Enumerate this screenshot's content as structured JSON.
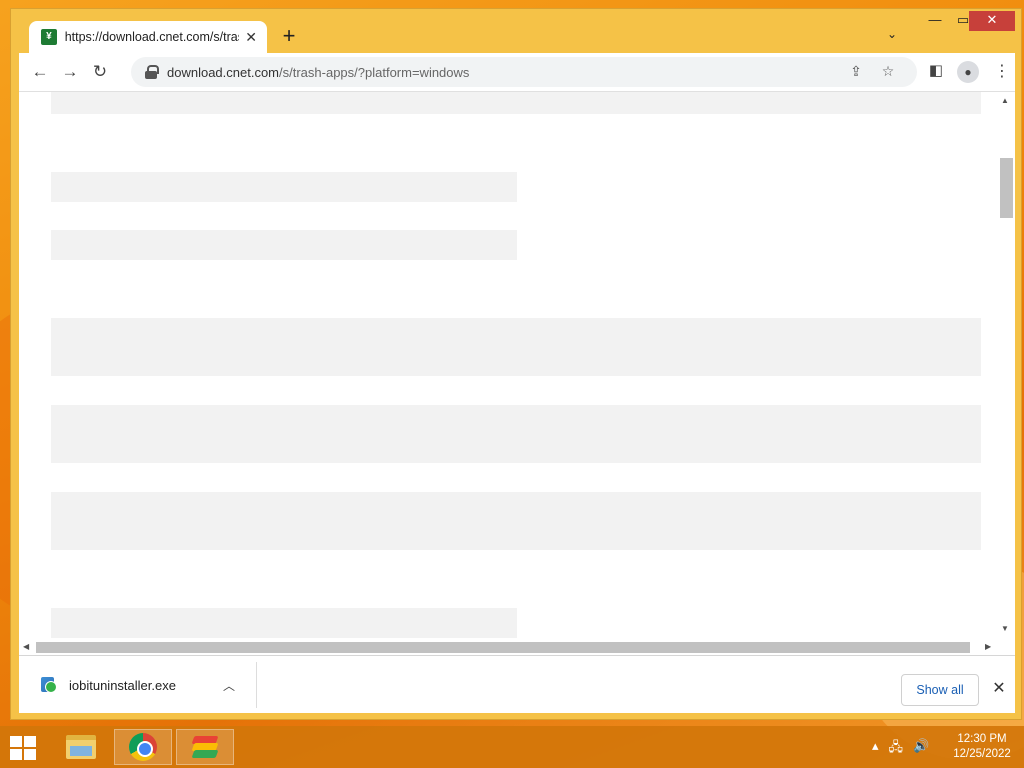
{
  "browser": {
    "tab": {
      "title": "https://download.cnet.com/s/trash-apps/?platform=windows",
      "favicon_letter": "¥"
    },
    "address": {
      "domain": "download.cnet.com",
      "path": "/s/trash-apps/?platform=windows"
    }
  },
  "download_bar": {
    "file_name": "iobituninstaller.exe",
    "show_all_label": "Show all"
  },
  "taskbar": {
    "time": "12:30 PM",
    "date": "12/25/2022"
  },
  "colors": {
    "frame": "#f5c247",
    "close_button": "#c7403a",
    "placeholder": "#f2f2f2",
    "link_blue": "#1a5fb4"
  }
}
